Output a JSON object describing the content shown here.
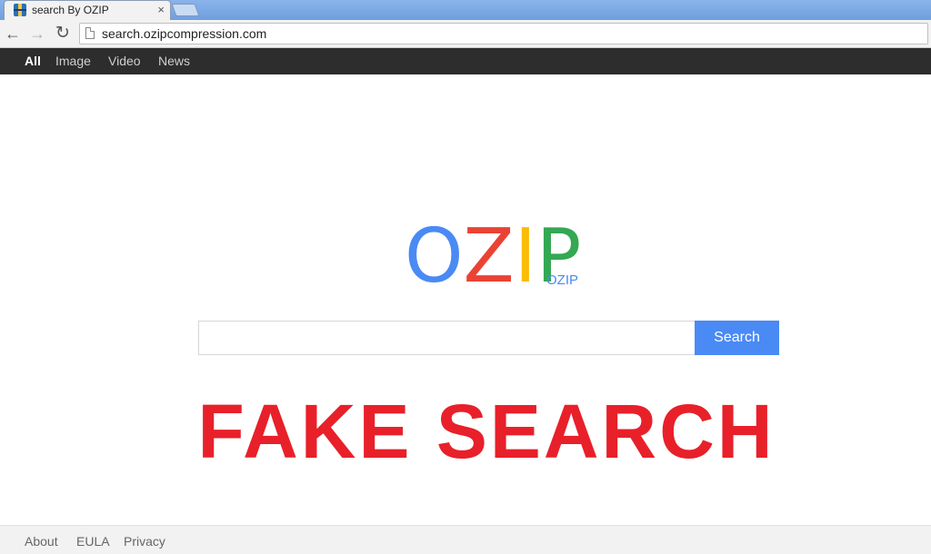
{
  "browser": {
    "tab_title": "search By OZIP",
    "tab_close": "×",
    "url": "search.ozipcompression.com",
    "icons": {
      "favicon": "ozip-favicon-icon",
      "back": "back-arrow-icon",
      "forward": "forward-arrow-icon",
      "reload": "reload-icon",
      "page": "page-icon"
    }
  },
  "nav": {
    "items": [
      {
        "label": "All",
        "active": true
      },
      {
        "label": "Image",
        "active": false
      },
      {
        "label": "Video",
        "active": false
      },
      {
        "label": "News",
        "active": false
      }
    ]
  },
  "logo": {
    "letters": [
      "O",
      "Z",
      "I",
      "P"
    ],
    "colors": [
      "#4a8af4",
      "#ea4335",
      "#fbbc05",
      "#34a853"
    ],
    "subtext": "OZIP"
  },
  "search": {
    "value": "",
    "button_label": "Search",
    "button_color": "#4a8af4"
  },
  "overlay": {
    "text": "FAKE SEARCH",
    "color": "#e8202a"
  },
  "footer": {
    "links": [
      "About",
      "EULA",
      "Privacy"
    ]
  }
}
